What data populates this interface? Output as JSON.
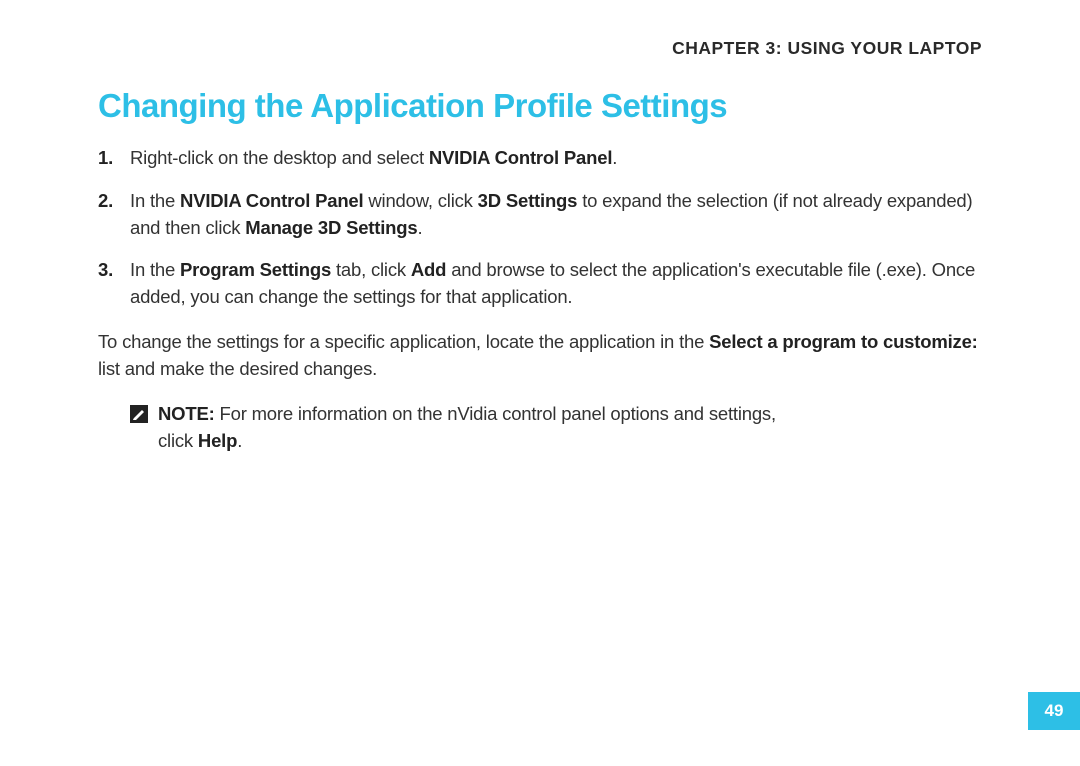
{
  "chapter": "CHAPTER 3: USING YOUR LAPTOP",
  "heading": "Changing the Application Profile Settings",
  "steps": {
    "s1_a": "Right-click on the desktop and select ",
    "s1_b": "NVIDIA Control Panel",
    "s1_c": ".",
    "s2_a": "In the ",
    "s2_b": "NVIDIA Control Panel",
    "s2_c": " window, click ",
    "s2_d": "3D Settings",
    "s2_e": " to expand the selection (if not already expanded) and then click ",
    "s2_f": "Manage 3D Settings",
    "s2_g": ".",
    "s3_a": "In the ",
    "s3_b": "Program Settings",
    "s3_c": " tab, click ",
    "s3_d": "Add",
    "s3_e": " and browse to select the application's executable file (.exe). Once added, you can change the settings for that application."
  },
  "body": {
    "a": "To change the settings for a specific application, locate the application in the ",
    "b": "Select a program to customize:",
    "c": " list and make the desired changes."
  },
  "note": {
    "label": "NOTE:",
    "line1_rest": " For more information on the nVidia control panel options and settings,",
    "line2_a": "click  ",
    "line2_b": "Help",
    "line2_c": "."
  },
  "page_number": "49"
}
